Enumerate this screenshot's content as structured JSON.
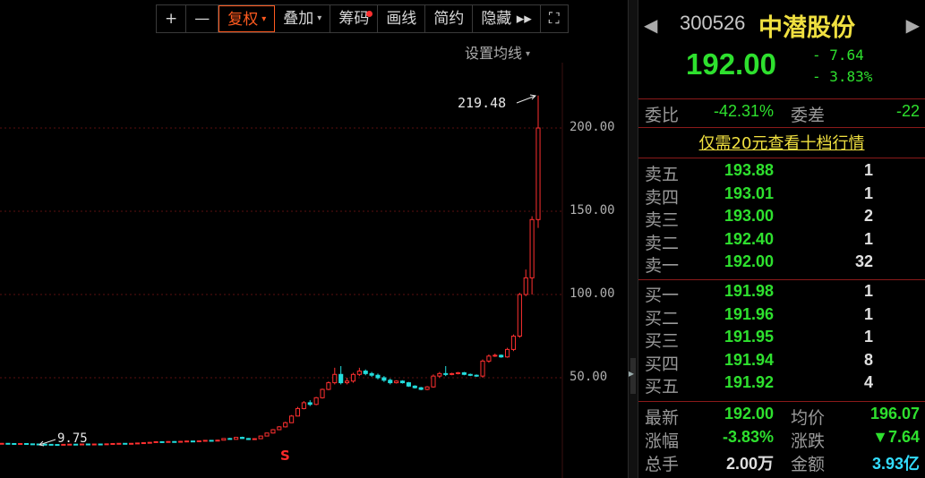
{
  "toolbar": {
    "buttons": [
      {
        "label": "+"
      },
      {
        "label": "—"
      },
      {
        "label": "复权",
        "caret": "▾"
      },
      {
        "label": "叠加",
        "caret": "▾"
      },
      {
        "label": "筹码"
      },
      {
        "label": "画线"
      },
      {
        "label": "简约"
      },
      {
        "label": "隐藏 ▸▸"
      },
      {
        "label": "⛶"
      }
    ]
  },
  "chart": {
    "ma_setting": "设置均线",
    "ma_caret": "▾",
    "price_axis": [
      "200.00",
      "150.00",
      "100.00",
      "50.00"
    ],
    "max_label": "219.48",
    "min_label": "9.75",
    "signal": "S",
    "colors": {
      "up": "#ff3030",
      "down": "#22dddd",
      "grid": "#5a1010"
    }
  },
  "chart_data": {
    "type": "candlestick",
    "title": "",
    "y_ticks": [
      50,
      100,
      150,
      200
    ],
    "ylim": [
      0,
      230
    ],
    "max_price": 219.48,
    "min_price": 9.75,
    "candles": [
      [
        10.6,
        10.6,
        10.8,
        10.4
      ],
      [
        10.6,
        10.5,
        10.7,
        10.3
      ],
      [
        10.5,
        10.4,
        10.6,
        10.2
      ],
      [
        10.4,
        10.5,
        10.6,
        10.3
      ],
      [
        10.5,
        10.3,
        10.6,
        10.2
      ],
      [
        10.3,
        10.2,
        10.4,
        10.0
      ],
      [
        10.2,
        10.1,
        10.3,
        9.9
      ],
      [
        10.1,
        10.0,
        10.2,
        9.9
      ],
      [
        10.0,
        9.9,
        10.1,
        9.8
      ],
      [
        9.9,
        9.85,
        10.0,
        9.75
      ],
      [
        9.85,
        10.0,
        10.1,
        9.8
      ],
      [
        10.0,
        10.1,
        10.2,
        9.9
      ],
      [
        10.1,
        10.0,
        10.2,
        9.9
      ],
      [
        10.0,
        10.2,
        10.3,
        9.9
      ],
      [
        10.2,
        10.1,
        10.3,
        10.0
      ],
      [
        10.1,
        10.2,
        10.3,
        10.0
      ],
      [
        10.2,
        10.0,
        10.3,
        9.9
      ],
      [
        10.0,
        10.3,
        10.4,
        9.9
      ],
      [
        10.3,
        10.5,
        10.6,
        10.2
      ],
      [
        10.5,
        10.6,
        10.7,
        10.4
      ],
      [
        10.6,
        10.4,
        10.7,
        10.3
      ],
      [
        10.4,
        10.6,
        10.7,
        10.3
      ],
      [
        10.6,
        10.8,
        10.9,
        10.5
      ],
      [
        10.8,
        11.0,
        11.1,
        10.7
      ],
      [
        11.0,
        11.2,
        11.4,
        10.9
      ],
      [
        11.2,
        11.6,
        11.8,
        11.1
      ],
      [
        11.6,
        11.4,
        11.8,
        11.2
      ],
      [
        11.4,
        11.7,
        11.9,
        11.3
      ],
      [
        11.7,
        11.5,
        11.9,
        11.4
      ],
      [
        11.5,
        11.8,
        12.0,
        11.4
      ],
      [
        11.8,
        12.0,
        12.2,
        11.7
      ],
      [
        12.0,
        11.8,
        12.2,
        11.6
      ],
      [
        11.8,
        12.1,
        12.3,
        11.7
      ],
      [
        12.1,
        12.4,
        12.6,
        12.0
      ],
      [
        12.4,
        12.2,
        12.6,
        12.0
      ],
      [
        12.2,
        12.5,
        12.8,
        12.1
      ],
      [
        12.5,
        13.5,
        13.7,
        12.4
      ],
      [
        13.5,
        13.0,
        13.9,
        12.8
      ],
      [
        13.0,
        14.2,
        14.4,
        12.9
      ],
      [
        14.2,
        13.5,
        14.6,
        13.3
      ],
      [
        13.5,
        12.9,
        13.8,
        12.6
      ],
      [
        12.9,
        13.4,
        13.6,
        12.7
      ],
      [
        13.4,
        15.0,
        15.2,
        13.3
      ],
      [
        15.0,
        16.8,
        17.0,
        14.8
      ],
      [
        16.8,
        18.8,
        19.2,
        16.5
      ],
      [
        18.8,
        20.5,
        21.0,
        18.5
      ],
      [
        20.5,
        23.0,
        23.6,
        20.1
      ],
      [
        23.0,
        27.0,
        27.6,
        22.8
      ],
      [
        27.0,
        31.5,
        32.5,
        26.8
      ],
      [
        31.5,
        35.0,
        36.0,
        31.0
      ],
      [
        35.0,
        34.0,
        36.5,
        33.0
      ],
      [
        34.0,
        38.0,
        38.5,
        33.5
      ],
      [
        38.0,
        43.0,
        43.5,
        37.5
      ],
      [
        43.0,
        47.0,
        47.8,
        42.5
      ],
      [
        47.0,
        52.0,
        56.0,
        46.0
      ],
      [
        52.0,
        47.0,
        57.0,
        46.0
      ],
      [
        47.0,
        48.0,
        50.0,
        46.0
      ],
      [
        48.0,
        52.0,
        53.0,
        47.0
      ],
      [
        52.0,
        54.0,
        56.0,
        51.0
      ],
      [
        54.0,
        52.5,
        55.0,
        51.5
      ],
      [
        52.5,
        51.5,
        53.5,
        50.5
      ],
      [
        51.5,
        50.0,
        52.5,
        49.0
      ],
      [
        50.0,
        48.5,
        51.0,
        47.5
      ],
      [
        48.5,
        47.0,
        49.5,
        46.0
      ],
      [
        47.0,
        48.0,
        48.5,
        46.5
      ],
      [
        48.0,
        47.0,
        48.5,
        46.5
      ],
      [
        47.0,
        45.0,
        47.5,
        44.5
      ],
      [
        45.0,
        44.0,
        45.5,
        43.5
      ],
      [
        44.0,
        43.0,
        44.5,
        42.5
      ],
      [
        43.0,
        44.5,
        45.0,
        42.5
      ],
      [
        44.5,
        51.0,
        52.0,
        44.0
      ],
      [
        51.0,
        52.5,
        53.5,
        50.0
      ],
      [
        52.5,
        52.0,
        57.0,
        51.0
      ],
      [
        52.0,
        52.5,
        53.0,
        51.5
      ],
      [
        52.5,
        53.0,
        53.5,
        52.0
      ],
      [
        53.0,
        52.0,
        53.5,
        51.5
      ],
      [
        52.0,
        51.5,
        52.5,
        51.0
      ],
      [
        51.5,
        51.0,
        52.0,
        50.5
      ],
      [
        51.0,
        60.0,
        61.0,
        50.0
      ],
      [
        60.0,
        63.0,
        64.0,
        59.0
      ],
      [
        63.0,
        63.5,
        64.5,
        62.5
      ],
      [
        63.5,
        62.5,
        64.0,
        62.0
      ],
      [
        62.5,
        67.0,
        68.0,
        62.0
      ],
      [
        67.0,
        75.0,
        76.0,
        66.0
      ],
      [
        75.0,
        100.0,
        101.0,
        74.0
      ],
      [
        100.0,
        110.0,
        115.0,
        99.0
      ],
      [
        110.0,
        145.0,
        147.0,
        100.0
      ],
      [
        145.0,
        200.0,
        219.48,
        140.0
      ]
    ]
  },
  "quote": {
    "nav_left": "◀",
    "nav_right": "▶",
    "code": "300526",
    "name": "中潜股份",
    "price": "192.00",
    "change": "- 7.64",
    "change_pct": "- 3.83%",
    "weibi_label": "委比",
    "weibi": "-42.31%",
    "weicha_label": "委差",
    "weicha": "-22",
    "promo": "仅需20元查看十档行情",
    "asks": [
      {
        "label": "卖五",
        "price": "193.88",
        "vol": "1"
      },
      {
        "label": "卖四",
        "price": "193.01",
        "vol": "1"
      },
      {
        "label": "卖三",
        "price": "193.00",
        "vol": "2"
      },
      {
        "label": "卖二",
        "price": "192.40",
        "vol": "1"
      },
      {
        "label": "卖一",
        "price": "192.00",
        "vol": "32"
      }
    ],
    "bids": [
      {
        "label": "买一",
        "price": "191.98",
        "vol": "1"
      },
      {
        "label": "买二",
        "price": "191.96",
        "vol": "1"
      },
      {
        "label": "买三",
        "price": "191.95",
        "vol": "1"
      },
      {
        "label": "买四",
        "price": "191.94",
        "vol": "8"
      },
      {
        "label": "买五",
        "price": "191.92",
        "vol": "4"
      }
    ],
    "stats": {
      "last_label": "最新",
      "last": "192.00",
      "avg_label": "均价",
      "avg": "196.07",
      "pct_label": "涨幅",
      "pct": "-3.83%",
      "chg_label": "涨跌",
      "chg": "▼7.64",
      "hand_label": "总手",
      "hand": "2.00万",
      "amt_label": "金额",
      "amt": "3.93亿"
    }
  }
}
